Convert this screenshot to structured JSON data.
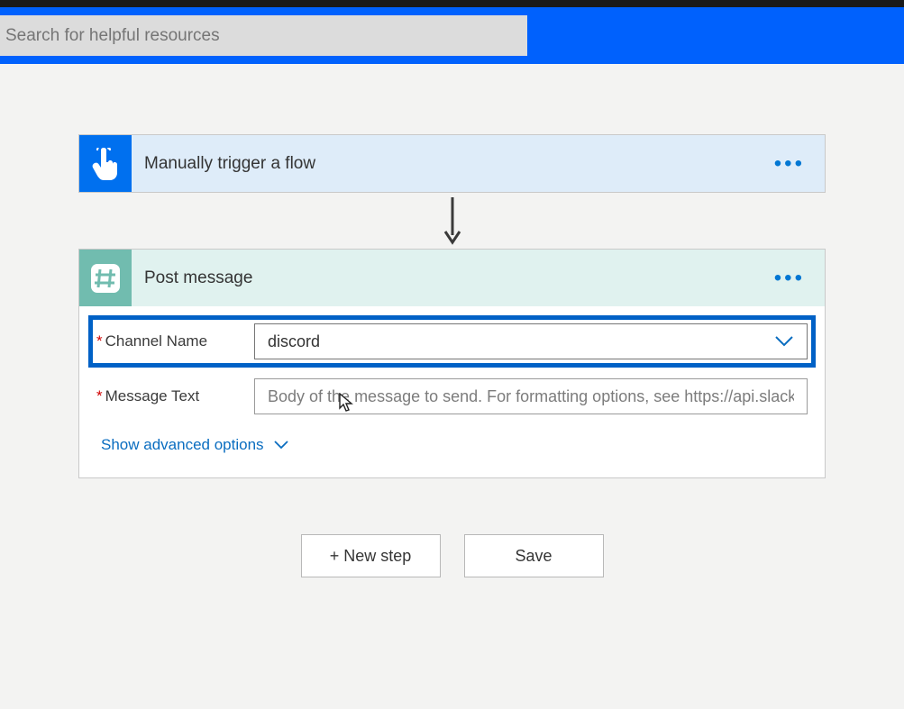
{
  "header": {
    "search_placeholder": "Search for helpful resources"
  },
  "trigger_card": {
    "title": "Manually trigger a flow"
  },
  "action_card": {
    "title": "Post message",
    "fields": {
      "channel": {
        "label": "Channel Name",
        "value": "discord"
      },
      "message": {
        "label": "Message Text",
        "placeholder": "Body of the message to send. For formatting options, see https://api.slack.com/"
      }
    },
    "advanced_label": "Show advanced options"
  },
  "buttons": {
    "new_step": "+ New step",
    "save": "Save"
  }
}
